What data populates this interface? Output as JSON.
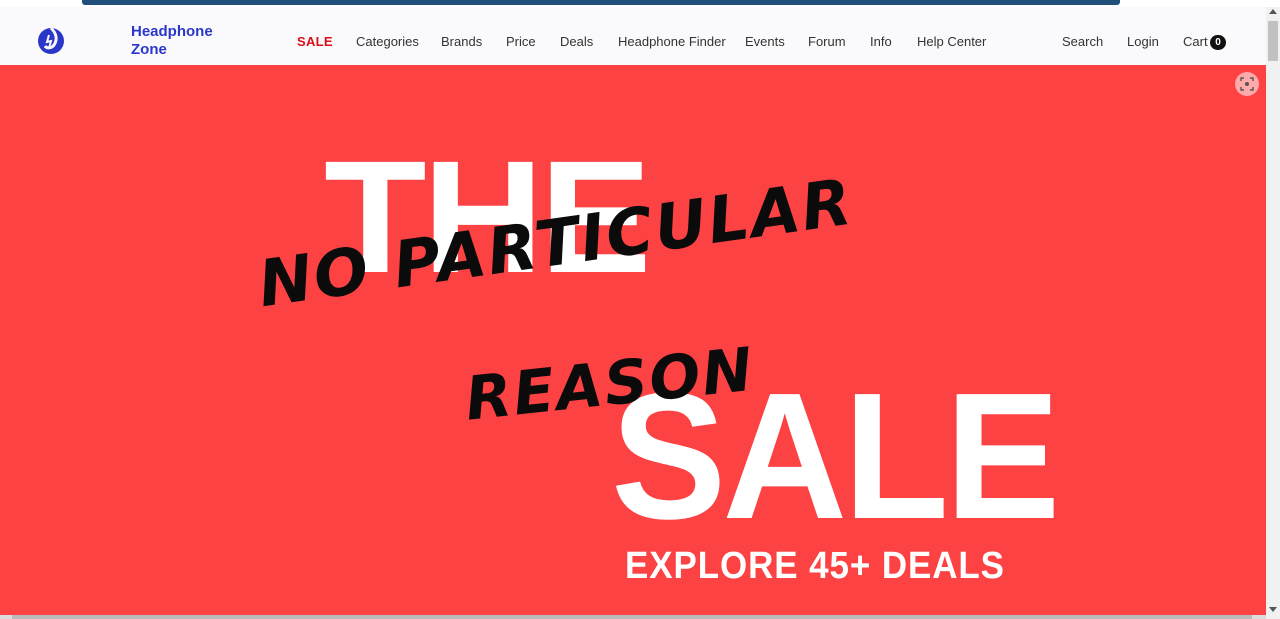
{
  "header": {
    "brand": "Headphone Zone",
    "logo_icon": "headphone-zone-logo-icon",
    "brand_color": "#2b37c8",
    "nav": {
      "sale": "SALE",
      "categories": "Categories",
      "brands": "Brands",
      "price": "Price",
      "deals": "Deals",
      "finder": "Headphone Finder",
      "events": "Events",
      "forum": "Forum",
      "info": "Info",
      "help": "Help Center"
    },
    "search": "Search",
    "login": "Login",
    "cart": "Cart",
    "cart_count": "0"
  },
  "hero": {
    "background": "#fd4244",
    "line_the": "THE",
    "line_sale": "SALE",
    "scrawl_1": "NO PARTICULAR",
    "scrawl_2": "REASON",
    "cta": "EXPLORE 45+ DEALS",
    "scan_icon": "visual-search-icon"
  }
}
